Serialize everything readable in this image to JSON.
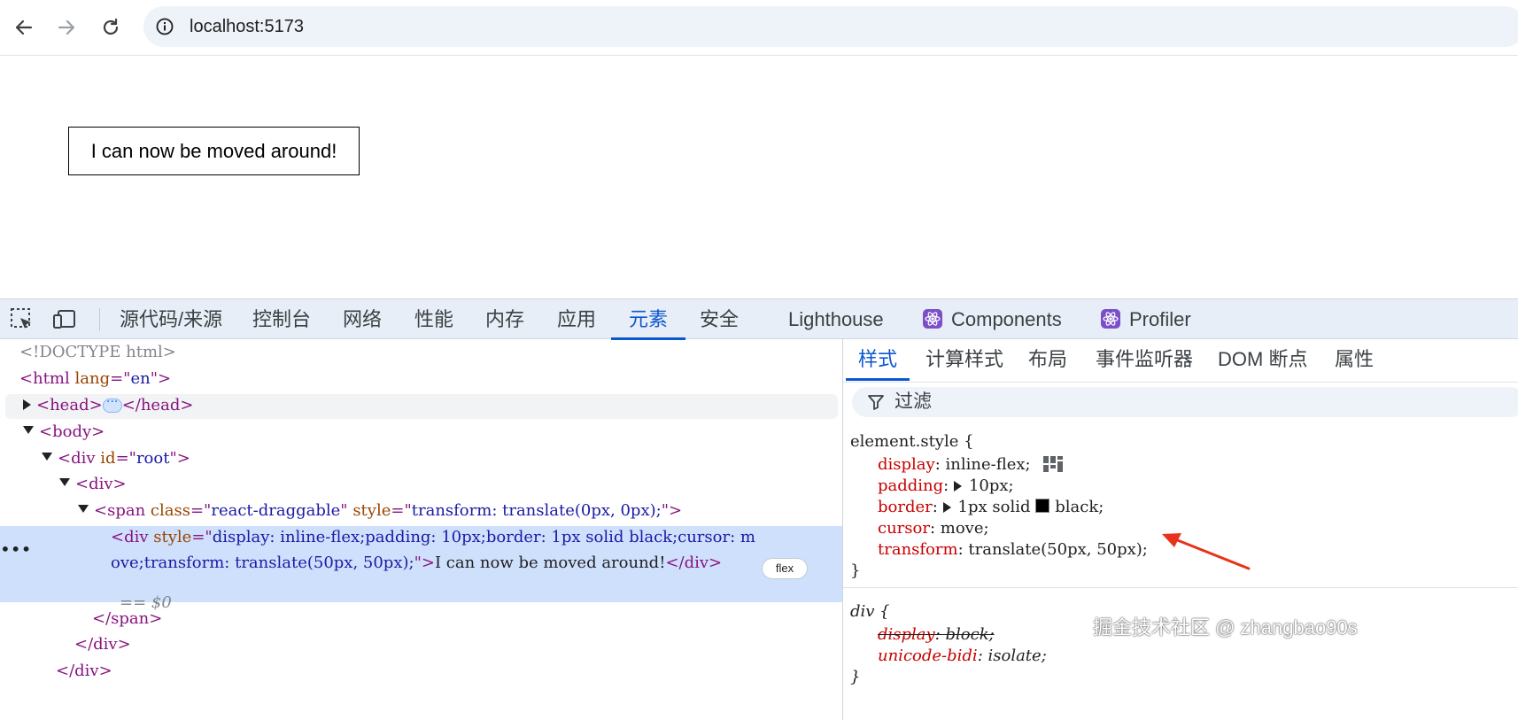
{
  "browser": {
    "url": "localhost:5173"
  },
  "page": {
    "draggable_text": "I can now be moved around!"
  },
  "devtools": {
    "tabs": [
      "源代码/来源",
      "控制台",
      "网络",
      "性能",
      "内存",
      "应用",
      "元素",
      "安全",
      "Lighthouse",
      "Components",
      "Profiler"
    ],
    "active_tab": "元素",
    "elements": {
      "doctype": "<!DOCTYPE html>",
      "html_tag": "html",
      "html_attr": "lang",
      "html_val": "en",
      "head": "head",
      "body": "body",
      "root_attr": "id",
      "root_val": "root",
      "div": "div",
      "span": "span",
      "span_class_attr": "class",
      "span_class_val": "react-draggable",
      "span_style_attr": "style",
      "span_style_val": "transform: translate(0px, 0px);",
      "sel_style_attr": "style",
      "sel_style_val_1": "display: inline-flex;padding: 10px;border: 1px solid black;cursor: m",
      "sel_style_val_2": "ove;transform: translate(50px, 50px);",
      "sel_text": "I can now be moved around!",
      "flex_badge": "flex",
      "dollar0": "== $0",
      "more": "•••"
    },
    "styles": {
      "sub_tabs": [
        "样式",
        "计算样式",
        "布局",
        "事件监听器",
        "DOM 断点",
        "属性"
      ],
      "filter": "过滤",
      "element_style_selector": "element.style {",
      "rules": [
        {
          "prop": "display",
          "value": "inline-flex;"
        },
        {
          "prop": "padding",
          "value": "10px;"
        },
        {
          "prop": "border",
          "value_pre": "1px solid",
          "value_post": "black;"
        },
        {
          "prop": "cursor",
          "value": "move;"
        },
        {
          "prop": "transform",
          "value": "translate(50px, 50px);"
        }
      ],
      "close_brace": "}",
      "div_selector": "div {",
      "ua_rules": [
        {
          "prop": "display",
          "value": "block;"
        },
        {
          "prop": "unicode-bidi",
          "value": "isolate;"
        }
      ]
    }
  },
  "watermark": "掘金技术社区 @ zhangbao90s",
  "colors": {
    "accent": "#0b57d0",
    "selected_row": "#cfe0fc",
    "css_prop": "#c80000",
    "tag": "#881280",
    "arrow": "#e8331c"
  }
}
